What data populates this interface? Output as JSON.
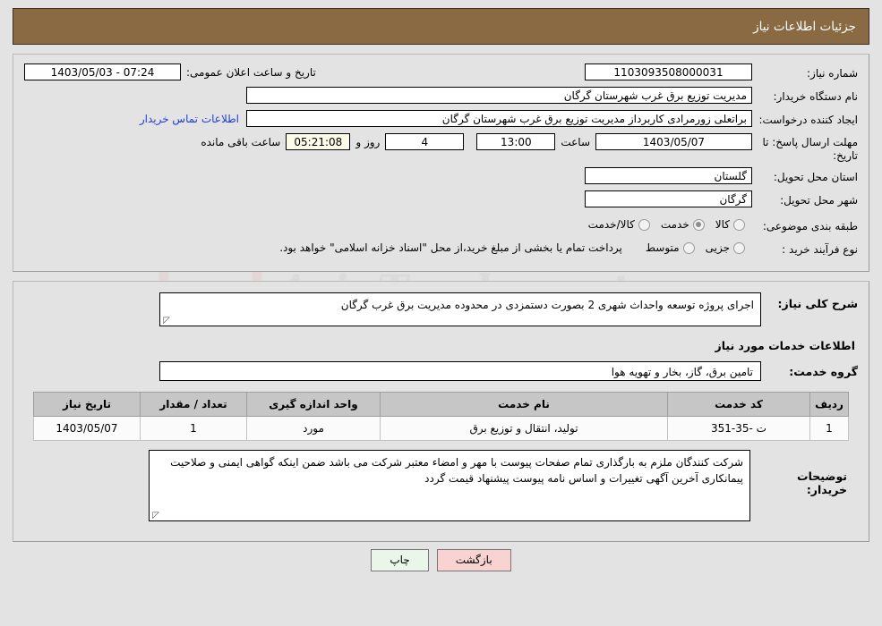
{
  "header": {
    "title": "جزئیات اطلاعات نیاز"
  },
  "form": {
    "need_number_label": "شماره نیاز:",
    "need_number_value": "1103093508000031",
    "announce_datetime_label": "تاریخ و ساعت اعلان عمومی:",
    "announce_datetime_value": "07:24 - 1403/05/03",
    "buyer_org_label": "نام دستگاه خریدار:",
    "buyer_org_value": "مدیریت توزیع برق غرب شهرستان گرگان",
    "requester_label": "ایجاد کننده درخواست:",
    "requester_value": "براتعلی زورمرادی کاربرداز مدیریت توزیع برق غرب شهرستان گرگان",
    "contact_link": "اطلاعات تماس خریدار",
    "deadline_label": "مهلت ارسال پاسخ: تا تاریخ:",
    "deadline_date": "1403/05/07",
    "hour_label": "ساعت",
    "deadline_time": "13:00",
    "days_remaining": "4",
    "days_label": "روز و",
    "timer_value": "05:21:08",
    "timer_label": "ساعت باقی مانده",
    "province_label": "استان محل تحویل:",
    "province_value": "گلستان",
    "city_label": "شهر محل تحویل:",
    "city_value": "گرگان",
    "category_label": "طبقه بندی موضوعی:",
    "category_options": [
      {
        "label": "کالا",
        "selected": false
      },
      {
        "label": "خدمت",
        "selected": true
      },
      {
        "label": "کالا/خدمت",
        "selected": false
      }
    ],
    "process_label": "نوع فرآیند خرید :",
    "process_options": [
      {
        "label": "جزیی",
        "selected": false
      },
      {
        "label": "متوسط",
        "selected": false
      }
    ],
    "process_note": "پرداخت تمام یا بخشی از مبلغ خرید،از محل \"اسناد خزانه اسلامی\" خواهد بود."
  },
  "description": {
    "label": "شرح کلی نیاز:",
    "value": "اجرای پروژه توسعه واحداث شهری 2 بصورت دستمزدی در محدوده مدیریت برق غرب گرگان"
  },
  "services_section": {
    "heading": "اطلاعات خدمات مورد نیاز",
    "group_label": "گروه خدمت:",
    "group_value": "تامین برق، گاز، بخار و تهویه هوا"
  },
  "table": {
    "columns": [
      "ردیف",
      "کد خدمت",
      "نام خدمت",
      "واحد اندازه گیری",
      "تعداد / مقدار",
      "تاریخ نیاز"
    ],
    "rows": [
      {
        "radif": "1",
        "code": "ت -35-351",
        "name": "تولید، انتقال و توزیع برق",
        "unit": "مورد",
        "qty": "1",
        "date": "1403/05/07"
      }
    ]
  },
  "buyer_notes": {
    "label": "توضیحات خریدار:",
    "value": "شرکت کنندگان ملزم به بارگذاری تمام صفحات پیوست با مهر و امضاء معتبر شرکت می باشد ضمن اینکه گواهی ایمنی و صلاحیت پیمانکاری آخرین آگهی تغییرات و اساس نامه پیوست پیشنهاد قیمت گردد"
  },
  "footer": {
    "print_label": "چاپ",
    "back_label": "بازگشت"
  },
  "watermark": {
    "text": "AriaTender.net"
  }
}
